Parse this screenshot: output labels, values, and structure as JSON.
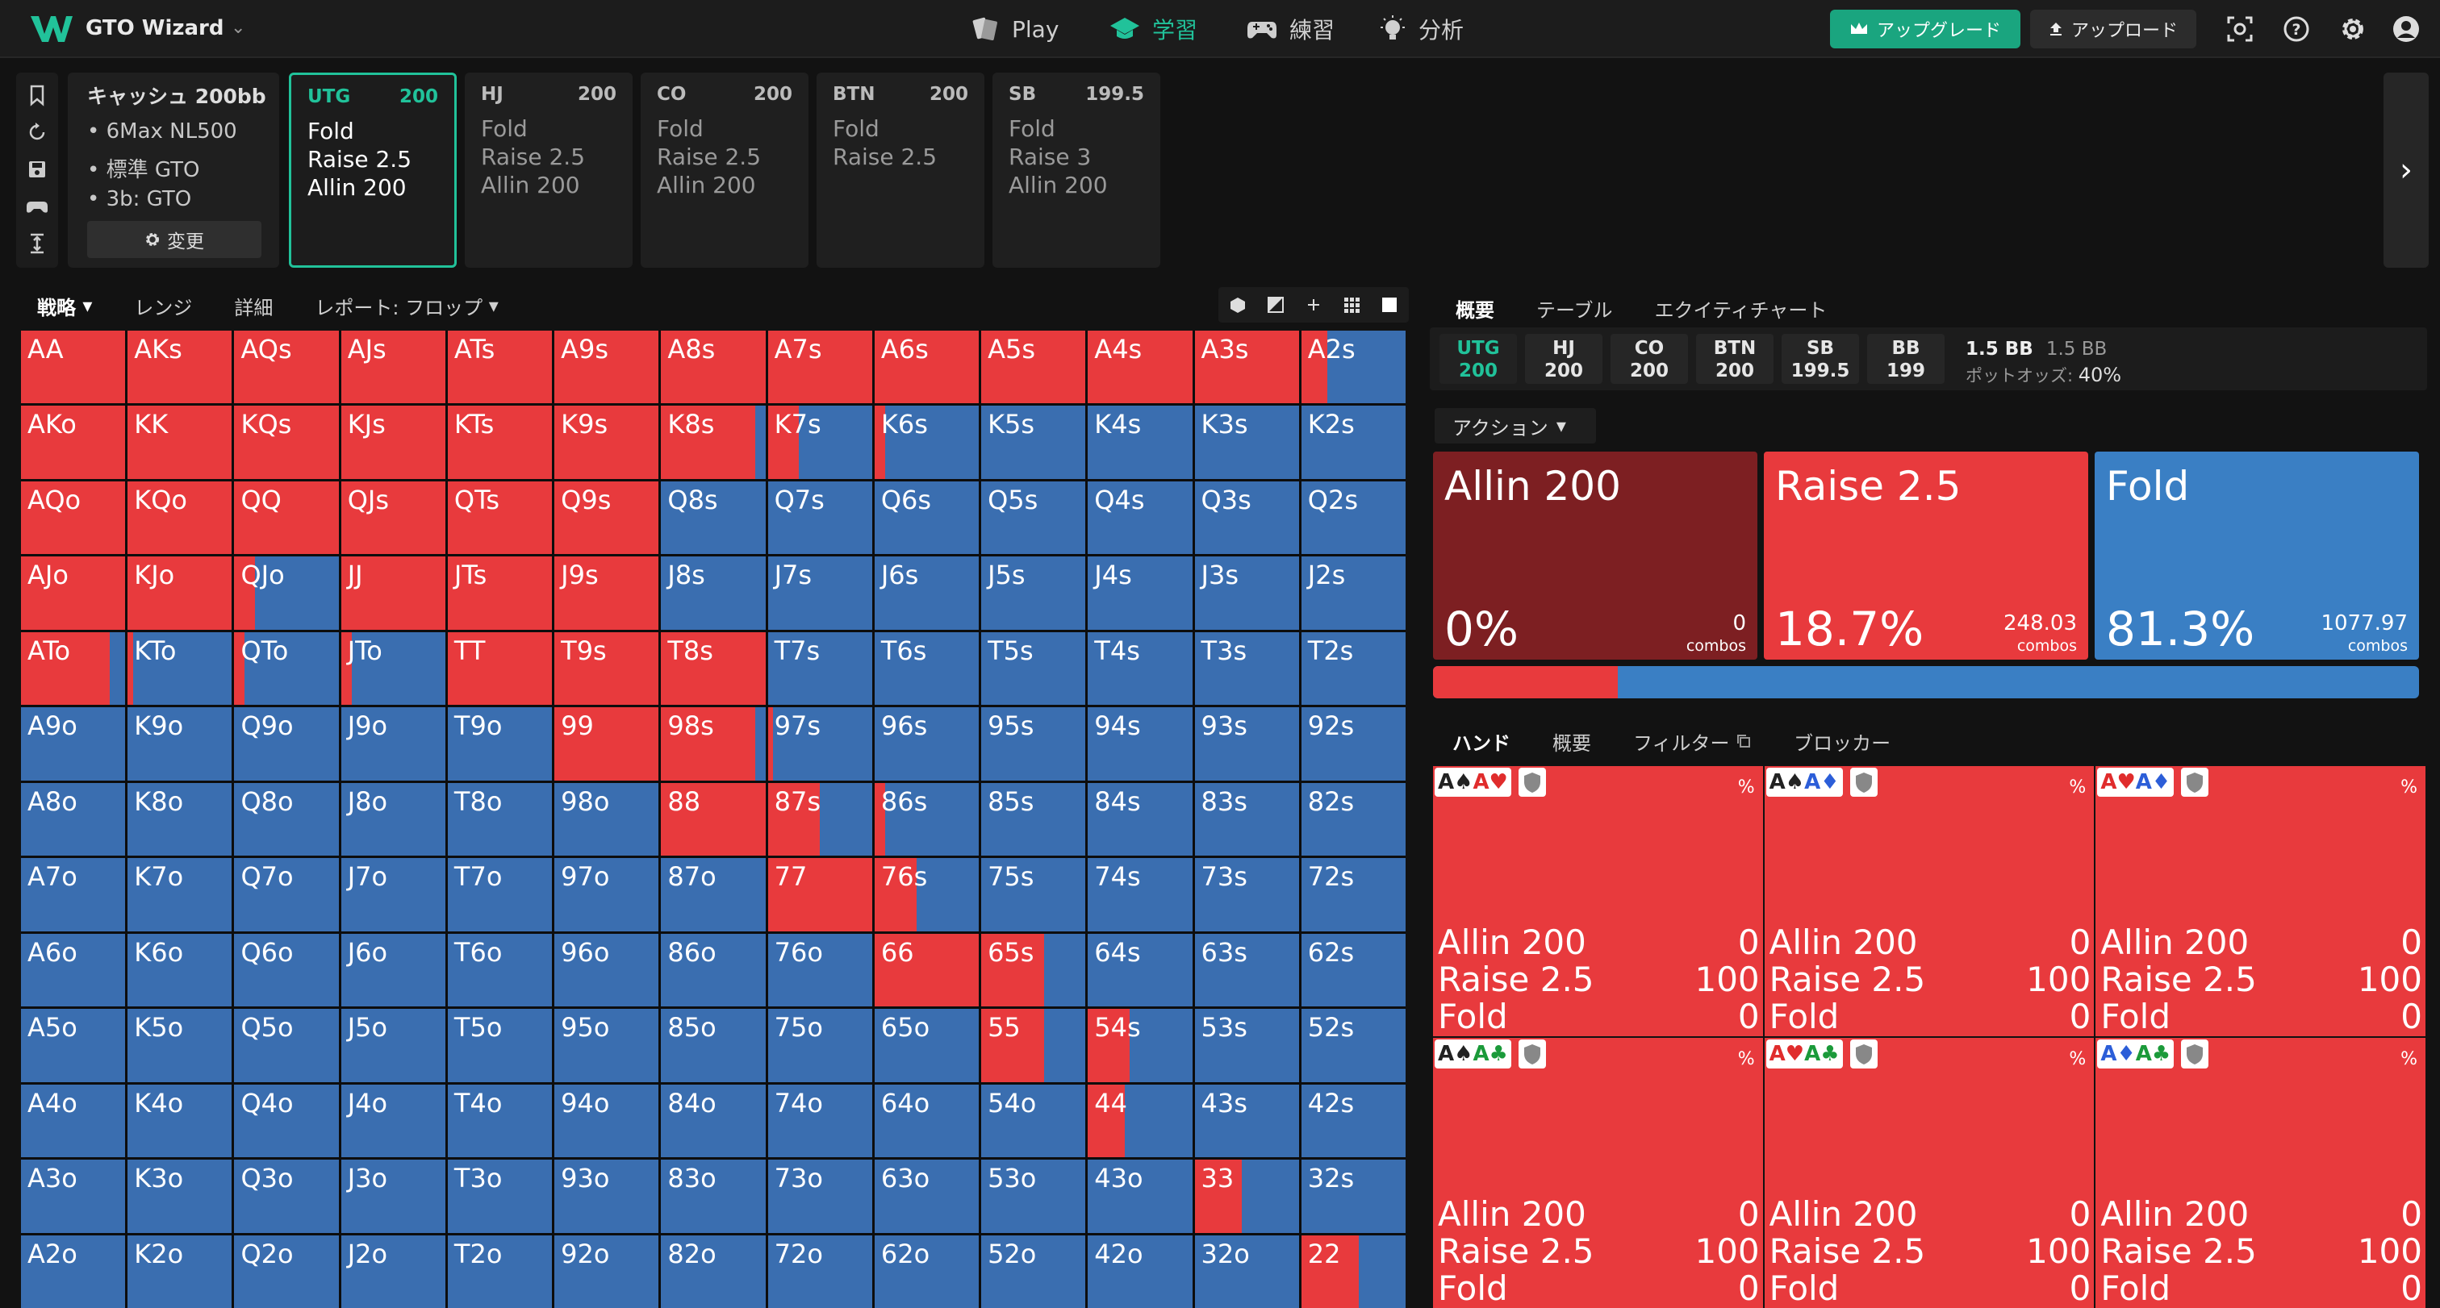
{
  "app": {
    "name": "GTO Wizard"
  },
  "nav": {
    "play": "Play",
    "study": "学習",
    "practice": "練習",
    "analyze": "分析"
  },
  "topright": {
    "upgrade": "アップグレード",
    "upload": "アップロード"
  },
  "info": {
    "title": "キャッシュ 200bb",
    "line1": "• 6Max NL500",
    "line2": "• 標準 GTO",
    "line3": "• 3b: GTO",
    "change": "変更"
  },
  "positions": [
    {
      "name": "UTG",
      "stack": "200",
      "a1": "Fold",
      "a2": "Raise 2.5",
      "a3": "Allin 200"
    },
    {
      "name": "HJ",
      "stack": "200",
      "a1": "Fold",
      "a2": "Raise 2.5",
      "a3": "Allin 200"
    },
    {
      "name": "CO",
      "stack": "200",
      "a1": "Fold",
      "a2": "Raise 2.5",
      "a3": "Allin 200"
    },
    {
      "name": "BTN",
      "stack": "200",
      "a1": "Fold",
      "a2": "Raise 2.5",
      "a3": ""
    },
    {
      "name": "SB",
      "stack": "199.5",
      "a1": "Fold",
      "a2": "Raise 3",
      "a3": "Allin 200"
    }
  ],
  "leftTabs": {
    "strategy": "戦略",
    "range": "レンジ",
    "detail": "詳細",
    "report": "レポート: フロップ"
  },
  "rightTabs": {
    "overview": "概要",
    "table": "テーブル",
    "equity": "エクイティチャート"
  },
  "seats": [
    {
      "name": "UTG",
      "stack": "200"
    },
    {
      "name": "HJ",
      "stack": "200"
    },
    {
      "name": "CO",
      "stack": "200"
    },
    {
      "name": "BTN",
      "stack": "200"
    },
    {
      "name": "SB",
      "stack": "199.5"
    },
    {
      "name": "BB",
      "stack": "199"
    }
  ],
  "pot": {
    "main": "1.5 BB",
    "secondary": "1.5 BB",
    "odds_label": "ポットオッズ:",
    "odds_value": "40%"
  },
  "action_select": "アクション",
  "actions": [
    {
      "name": "Allin 200",
      "pct": "0%",
      "combos": "0",
      "combos_label": "combos",
      "color": "#7d1f22"
    },
    {
      "name": "Raise 2.5",
      "pct": "18.7%",
      "combos": "248.03",
      "combos_label": "combos",
      "color": "#e83a3d"
    },
    {
      "name": "Fold",
      "pct": "81.3%",
      "combos": "1077.97",
      "combos_label": "combos",
      "color": "#3a7fc4"
    }
  ],
  "frequency": {
    "raise": 0.187,
    "fold": 0.813
  },
  "handTabs": {
    "hands": "ハンド",
    "overview": "概要",
    "filter": "フィルター",
    "blocker": "ブロッカー"
  },
  "combos": [
    {
      "c1": "A♠",
      "c2": "A♥",
      "pct": "%",
      "allin_label": "Allin 200",
      "allin": "0",
      "raise_label": "Raise 2.5",
      "raise": "100",
      "fold_label": "Fold",
      "fold": "0"
    },
    {
      "c1": "A♠",
      "c2": "A♦",
      "pct": "%",
      "allin_label": "Allin 200",
      "allin": "0",
      "raise_label": "Raise 2.5",
      "raise": "100",
      "fold_label": "Fold",
      "fold": "0"
    },
    {
      "c1": "A♥",
      "c2": "A♦",
      "pct": "%",
      "allin_label": "Allin 200",
      "allin": "0",
      "raise_label": "Raise 2.5",
      "raise": "100",
      "fold_label": "Fold",
      "fold": "0"
    },
    {
      "c1": "A♠",
      "c2": "A♣",
      "pct": "%",
      "allin_label": "Allin 200",
      "allin": "0",
      "raise_label": "Raise 2.5",
      "raise": "100",
      "fold_label": "Fold",
      "fold": "0"
    },
    {
      "c1": "A♥",
      "c2": "A♣",
      "pct": "%",
      "allin_label": "Allin 200",
      "allin": "0",
      "raise_label": "Raise 2.5",
      "raise": "100",
      "fold_label": "Fold",
      "fold": "0"
    },
    {
      "c1": "A♦",
      "c2": "A♣",
      "pct": "%",
      "allin_label": "Allin 200",
      "allin": "0",
      "raise_label": "Raise 2.5",
      "raise": "100",
      "fold_label": "Fold",
      "fold": "0"
    }
  ],
  "matrix": {
    "labels": [
      [
        "AA",
        "AKs",
        "AQs",
        "AJs",
        "ATs",
        "A9s",
        "A8s",
        "A7s",
        "A6s",
        "A5s",
        "A4s",
        "A3s",
        "A2s"
      ],
      [
        "AKo",
        "KK",
        "KQs",
        "KJs",
        "KTs",
        "K9s",
        "K8s",
        "K7s",
        "K6s",
        "K5s",
        "K4s",
        "K3s",
        "K2s"
      ],
      [
        "AQo",
        "KQo",
        "QQ",
        "QJs",
        "QTs",
        "Q9s",
        "Q8s",
        "Q7s",
        "Q6s",
        "Q5s",
        "Q4s",
        "Q3s",
        "Q2s"
      ],
      [
        "AJo",
        "KJo",
        "QJo",
        "JJ",
        "JTs",
        "J9s",
        "J8s",
        "J7s",
        "J6s",
        "J5s",
        "J4s",
        "J3s",
        "J2s"
      ],
      [
        "ATo",
        "KTo",
        "QTo",
        "JTo",
        "TT",
        "T9s",
        "T8s",
        "T7s",
        "T6s",
        "T5s",
        "T4s",
        "T3s",
        "T2s"
      ],
      [
        "A9o",
        "K9o",
        "Q9o",
        "J9o",
        "T9o",
        "99",
        "98s",
        "97s",
        "96s",
        "95s",
        "94s",
        "93s",
        "92s"
      ],
      [
        "A8o",
        "K8o",
        "Q8o",
        "J8o",
        "T8o",
        "98o",
        "88",
        "87s",
        "86s",
        "85s",
        "84s",
        "83s",
        "82s"
      ],
      [
        "A7o",
        "K7o",
        "Q7o",
        "J7o",
        "T7o",
        "97o",
        "87o",
        "77",
        "76s",
        "75s",
        "74s",
        "73s",
        "72s"
      ],
      [
        "A6o",
        "K6o",
        "Q6o",
        "J6o",
        "T6o",
        "96o",
        "86o",
        "76o",
        "66",
        "65s",
        "64s",
        "63s",
        "62s"
      ],
      [
        "A5o",
        "K5o",
        "Q5o",
        "J5o",
        "T5o",
        "95o",
        "85o",
        "75o",
        "65o",
        "55",
        "54s",
        "53s",
        "52s"
      ],
      [
        "A4o",
        "K4o",
        "Q4o",
        "J4o",
        "T4o",
        "94o",
        "84o",
        "74o",
        "64o",
        "54o",
        "44",
        "43s",
        "42s"
      ],
      [
        "A3o",
        "K3o",
        "Q3o",
        "J3o",
        "T3o",
        "93o",
        "83o",
        "73o",
        "63o",
        "53o",
        "43o",
        "33",
        "32s"
      ],
      [
        "A2o",
        "K2o",
        "Q2o",
        "J2o",
        "T2o",
        "92o",
        "82o",
        "72o",
        "62o",
        "52o",
        "42o",
        "32o",
        "22"
      ]
    ],
    "raise_freq": [
      [
        1,
        1,
        1,
        1,
        1,
        1,
        1,
        1,
        1,
        1,
        1,
        1,
        0.25
      ],
      [
        1,
        1,
        1,
        1,
        1,
        1,
        0.9,
        0.3,
        0.1,
        0,
        0,
        0,
        0
      ],
      [
        1,
        1,
        1,
        1,
        1,
        1,
        0,
        0,
        0,
        0,
        0,
        0,
        0
      ],
      [
        1,
        1,
        0.2,
        1,
        1,
        1,
        0,
        0,
        0,
        0,
        0,
        0,
        0
      ],
      [
        0.85,
        0.05,
        0.1,
        0.1,
        1,
        1,
        1,
        0,
        0,
        0,
        0,
        0,
        0
      ],
      [
        0,
        0,
        0,
        0,
        0,
        1,
        0.9,
        0.05,
        0,
        0,
        0,
        0,
        0
      ],
      [
        0,
        0,
        0,
        0,
        0,
        0,
        1,
        0.5,
        0.1,
        0,
        0,
        0,
        0
      ],
      [
        0,
        0,
        0,
        0,
        0,
        0,
        0,
        1,
        0.4,
        0,
        0,
        0,
        0
      ],
      [
        0,
        0,
        0,
        0,
        0,
        0,
        0,
        0,
        1,
        0.6,
        0,
        0,
        0
      ],
      [
        0,
        0,
        0,
        0,
        0,
        0,
        0,
        0,
        0,
        0.6,
        0.4,
        0,
        0
      ],
      [
        0,
        0,
        0,
        0,
        0,
        0,
        0,
        0,
        0,
        0,
        0.35,
        0,
        0
      ],
      [
        0,
        0,
        0,
        0,
        0,
        0,
        0,
        0,
        0,
        0,
        0,
        0.45,
        0
      ],
      [
        0,
        0,
        0,
        0,
        0,
        0,
        0,
        0,
        0,
        0,
        0,
        0,
        0.55
      ]
    ]
  }
}
